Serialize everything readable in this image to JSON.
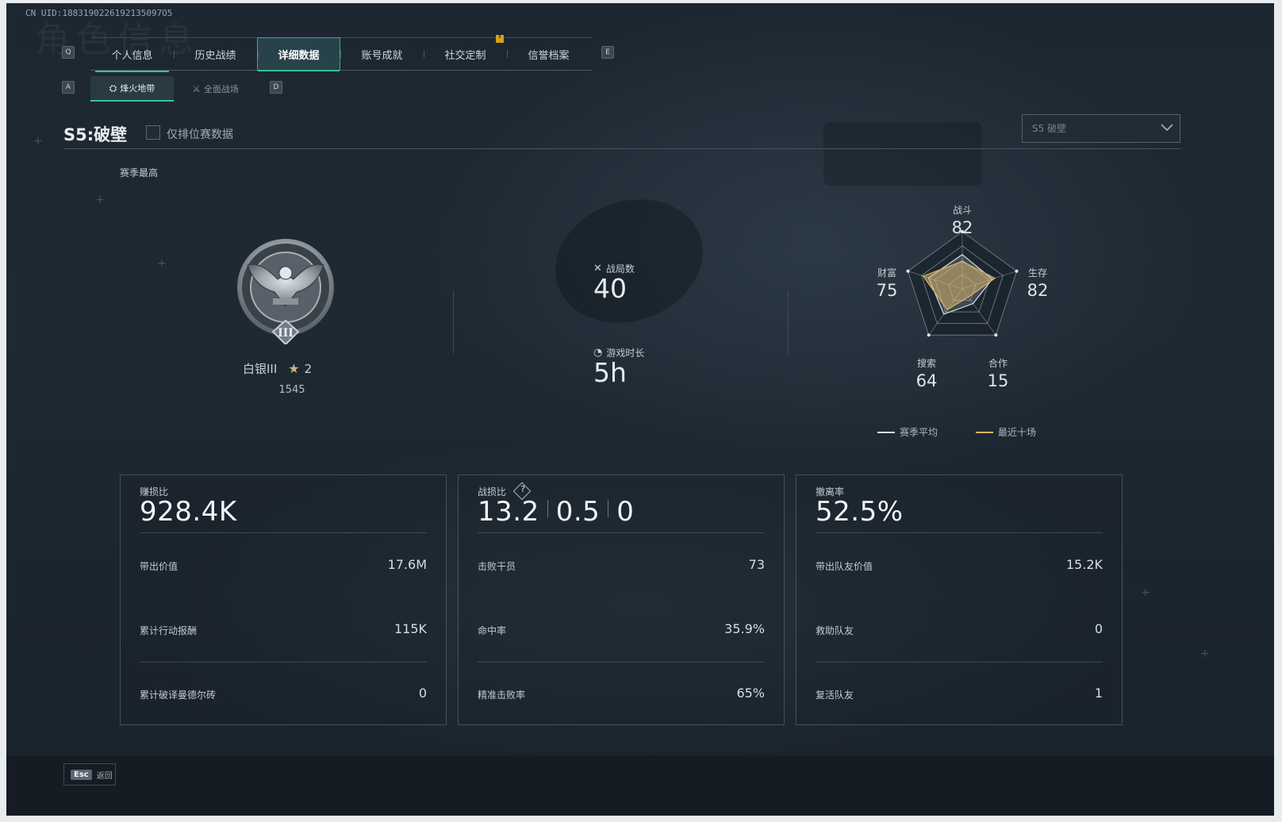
{
  "uid": "CN UID:1883190226192135097O5",
  "background_watermark": "角色信息",
  "tabs": {
    "left_key": "Q",
    "right_key": "E",
    "items": [
      {
        "label": "个人信息"
      },
      {
        "label": "历史战绩"
      },
      {
        "label": "详细数据"
      },
      {
        "label": "账号成就"
      },
      {
        "label": "社交定制"
      },
      {
        "label": "信誉档案"
      }
    ],
    "active_index": 2,
    "notification": "!"
  },
  "subtabs": {
    "left_key": "A",
    "right_key": "D",
    "items": [
      {
        "label": "烽火地带",
        "icon": "hazard-zone-icon"
      },
      {
        "label": "全面战场",
        "icon": "battlefield-icon"
      }
    ],
    "active_index": 0
  },
  "season": {
    "title": "S5:破壁",
    "ranked_only_label": "仅排位赛数据",
    "ranked_only_checked": false,
    "select_value": "S5 破壁"
  },
  "season_best_label": "赛季最高",
  "rank": {
    "name": "白银III",
    "stars": "2",
    "score": "1545",
    "badge_numeral": "III"
  },
  "summary": {
    "matches_label": "战局数",
    "matches_value": "40",
    "playtime_label": "游戏时长",
    "playtime_value": "5h"
  },
  "radar": {
    "axes": [
      {
        "name": "战斗",
        "value": "82"
      },
      {
        "name": "生存",
        "value": "82"
      },
      {
        "name": "合作",
        "value": "15"
      },
      {
        "name": "搜索",
        "value": "64"
      },
      {
        "name": "财富",
        "value": "75"
      }
    ],
    "season_avg": [
      0.6,
      0.55,
      0.32,
      0.55,
      0.62
    ],
    "recent_ten": [
      0.48,
      0.6,
      0.18,
      0.45,
      0.72
    ],
    "legend": [
      {
        "label": "赛季平均",
        "color": "#d9dee3"
      },
      {
        "label": "最近十场",
        "color": "#d6b46a"
      }
    ]
  },
  "cards": [
    {
      "label": "赚损比",
      "big": "928.4K",
      "rows": [
        {
          "label": "带出价值",
          "value": "17.6M"
        },
        {
          "label": "累计行动报酬",
          "value": "115K"
        },
        {
          "label": "累计破译曼德尔砖",
          "value": "0"
        }
      ]
    },
    {
      "label": "战损比",
      "help": "?",
      "big_parts": [
        "13.2",
        "0.5",
        "0"
      ],
      "rows": [
        {
          "label": "击败干员",
          "value": "73"
        },
        {
          "label": "命中率",
          "value": "35.9%"
        },
        {
          "label": "精准击败率",
          "value": "65%"
        }
      ]
    },
    {
      "label": "撤离率",
      "big": "52.5%",
      "rows": [
        {
          "label": "带出队友价值",
          "value": "15.2K"
        },
        {
          "label": "救助队友",
          "value": "0"
        },
        {
          "label": "复活队友",
          "value": "1"
        }
      ]
    }
  ],
  "footer": {
    "esc_key": "Esc",
    "back_label": "返回"
  },
  "colors": {
    "accent": "#39c19a",
    "gold": "#d6b46a",
    "background": "#1d2731"
  }
}
